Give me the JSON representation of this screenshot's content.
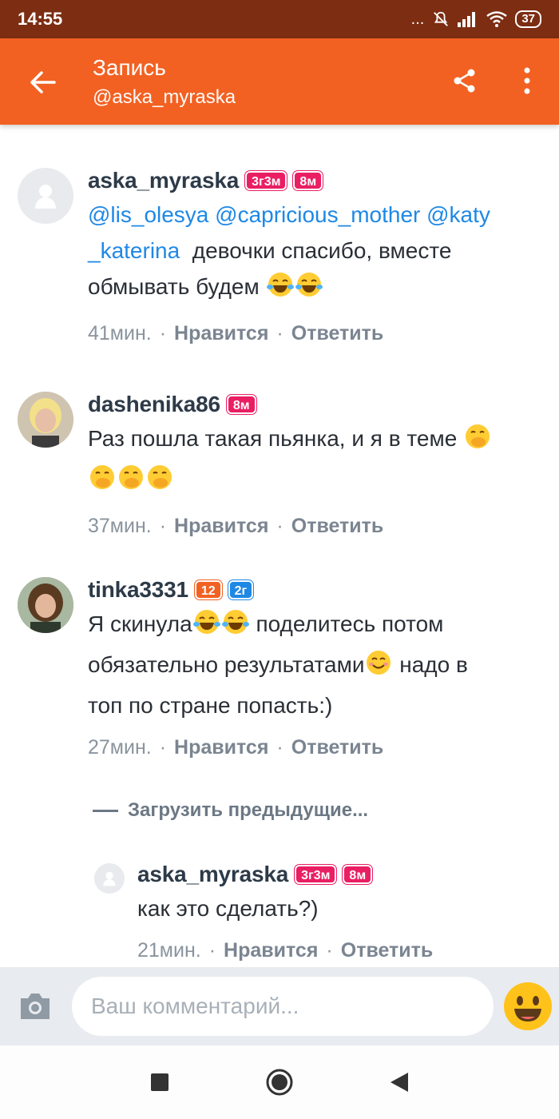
{
  "status_bar": {
    "time": "14:55",
    "dots": "...",
    "battery": "37"
  },
  "app_bar": {
    "title": "Запись",
    "subtitle": "@aska_myraska"
  },
  "colors": {
    "accent": "#f26122",
    "status_bar": "#7c2d12",
    "mention": "#1e88e5",
    "badge_pink": "#e91e63",
    "badge_orange": "#f26122",
    "badge_blue": "#1e88e5"
  },
  "comments": [
    {
      "author": "aska_myraska",
      "badges": [
        "3г3м",
        "8м"
      ],
      "mentions_line1": "@lis_olesya @capricious_mother @katy",
      "mentions_line2": "_katerina",
      "text_after": "девочки спасибо, вместе",
      "text_line3": "обмывать будем",
      "emojis": "laughing-tears x2",
      "time": "41мин.",
      "like": "Нравится",
      "reply": "Ответить"
    },
    {
      "author": "dashenika86",
      "badges": [
        "8м"
      ],
      "text_line1": "Раз пошла такая пьянка, и я в теме",
      "emojis": "hand-over-mouth x4",
      "time": "37мин.",
      "like": "Нравится",
      "reply": "Ответить"
    },
    {
      "author": "tinka3331",
      "badges": [
        "12",
        "2г"
      ],
      "text_line1a": "Я скинула",
      "text_line1b": "поделитесь потом",
      "text_line2a": "обязательно результатами",
      "text_line2b": "надо в",
      "text_line3": "топ по стране попасть:)",
      "time": "27мин.",
      "like": "Нравится",
      "reply": "Ответить"
    }
  ],
  "load_previous": "Загрузить предыдущие...",
  "reply_comment": {
    "author": "aska_myraska",
    "badges": [
      "3г3м",
      "8м"
    ],
    "text": "как это сделать?)",
    "time": "21мин.",
    "like": "Нравится",
    "reply": "Ответить"
  },
  "input": {
    "placeholder": "Ваш комментарий..."
  },
  "separator": "·"
}
